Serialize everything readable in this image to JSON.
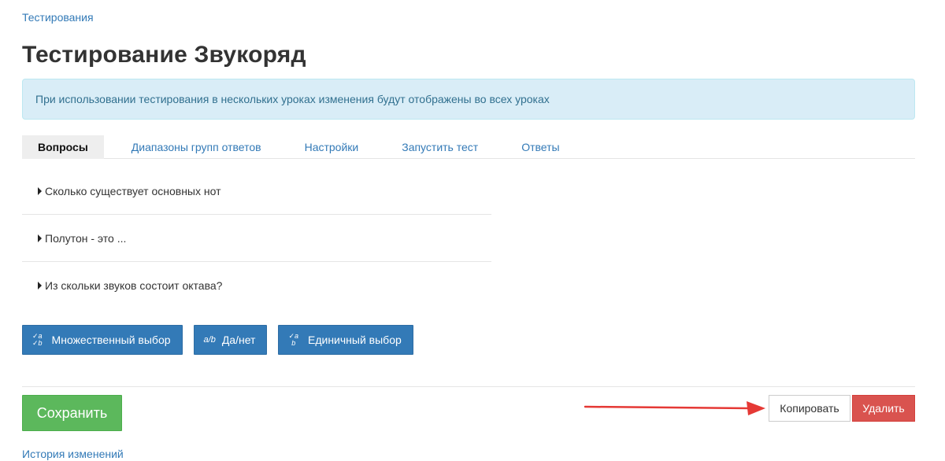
{
  "breadcrumb": "Тестирования",
  "page_title": "Тестирование Звукоряд",
  "alert_text": "При использовании тестирования в нескольких уроках изменения будут отображены во всех уроках",
  "tabs": [
    {
      "label": "Вопросы",
      "active": true
    },
    {
      "label": "Диапазоны групп ответов",
      "active": false
    },
    {
      "label": "Настройки",
      "active": false
    },
    {
      "label": "Запустить тест",
      "active": false
    },
    {
      "label": "Ответы",
      "active": false
    }
  ],
  "questions": [
    {
      "text": "Сколько существует основных нот"
    },
    {
      "text": "Полутон - это ..."
    },
    {
      "text": "Из скольки звуков состоит октава?"
    }
  ],
  "question_types": [
    {
      "icon_top": "✓a",
      "icon_bottom": "✓b",
      "label": "Множественный выбор"
    },
    {
      "icon": "a/b",
      "label": "Да/нет"
    },
    {
      "icon_top": "✓a",
      "icon_bottom": "b",
      "label": "Единичный выбор"
    }
  ],
  "actions": {
    "save": "Сохранить",
    "copy": "Копировать",
    "delete": "Удалить"
  },
  "history_link": "История изменений",
  "colors": {
    "primary": "#337ab7",
    "success": "#5cb85c",
    "danger": "#d9534f",
    "info_bg": "#d9edf7",
    "arrow": "#e53935"
  }
}
